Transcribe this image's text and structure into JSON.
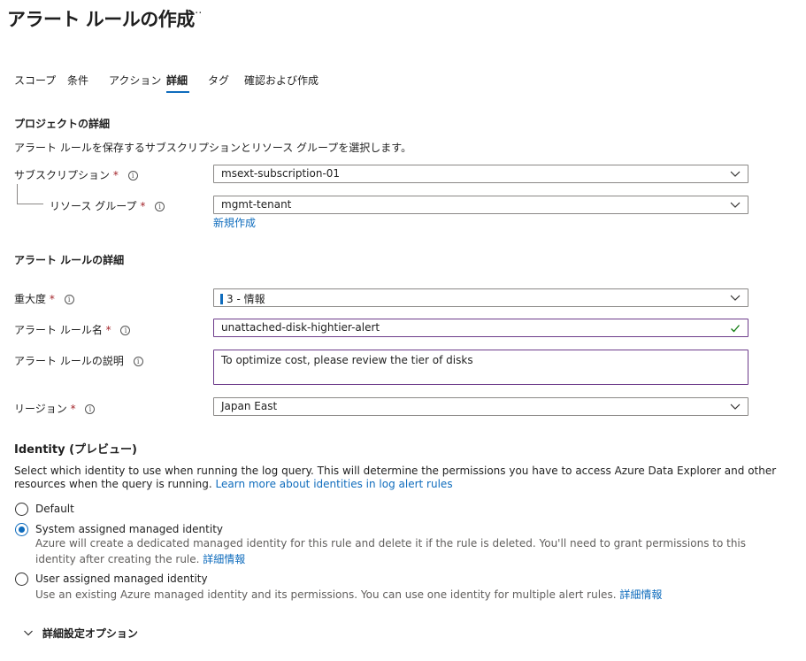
{
  "header": {
    "title": "アラート ルールの作成",
    "more_label": "···"
  },
  "tabs": [
    {
      "label": "スコープ",
      "active": false
    },
    {
      "label": "条件",
      "active": false
    },
    {
      "label": "アクション",
      "active": false
    },
    {
      "label": "詳細",
      "active": true
    },
    {
      "label": "タグ",
      "active": false
    },
    {
      "label": "確認および作成",
      "active": false
    }
  ],
  "project": {
    "heading": "プロジェクトの詳細",
    "description": "アラート ルールを保存するサブスクリプションとリソース グループを選択します。",
    "subscription": {
      "label": "サブスクリプション",
      "required": "*",
      "value": "msext-subscription-01"
    },
    "resource_group": {
      "label": "リソース グループ",
      "required": "*",
      "value": "mgmt-tenant"
    },
    "new_link": "新規作成"
  },
  "rule": {
    "heading": "アラート ルールの詳細",
    "severity": {
      "label": "重大度",
      "required": "*",
      "value": "3 - 情報"
    },
    "name": {
      "label": "アラート ルール名",
      "required": "*",
      "value": "unattached-disk-hightier-alert"
    },
    "description": {
      "label": "アラート ルールの説明",
      "value": "To optimize cost, please review the tier of disks"
    },
    "region": {
      "label": "リージョン",
      "required": "*",
      "value": "Japan East"
    }
  },
  "identity": {
    "heading": "Identity (プレビュー)",
    "text_line1": "Select which identity to use when running the log query. This will determine the permissions you have to access Azure Data Explorer and other",
    "text_line2": "resources when the query is running.",
    "learn_more": "Learn more about identities in log alert rules",
    "options": [
      {
        "label": "Default",
        "checked": false
      },
      {
        "label": "System assigned managed identity",
        "checked": true,
        "desc1": "Azure will create a dedicated managed identity for this rule and delete it if the rule is deleted. You'll need to grant permissions to this",
        "desc2": "identity after creating the rule.",
        "link": "詳細情報"
      },
      {
        "label": "User assigned managed identity",
        "checked": false,
        "desc1": "Use an existing Azure managed identity and its permissions. You can use one identity for multiple alert rules.",
        "link": "詳細情報"
      }
    ]
  },
  "advanced": {
    "label": "詳細設定オプション"
  },
  "colors": {
    "accent": "#0f6cbd",
    "required": "#a4262c",
    "focus_border": "#6d3c8b",
    "valid_check": "#107c10"
  },
  "icons": {
    "info": "info-icon",
    "chevron": "chevron-down-icon",
    "check": "checkmark-icon"
  }
}
